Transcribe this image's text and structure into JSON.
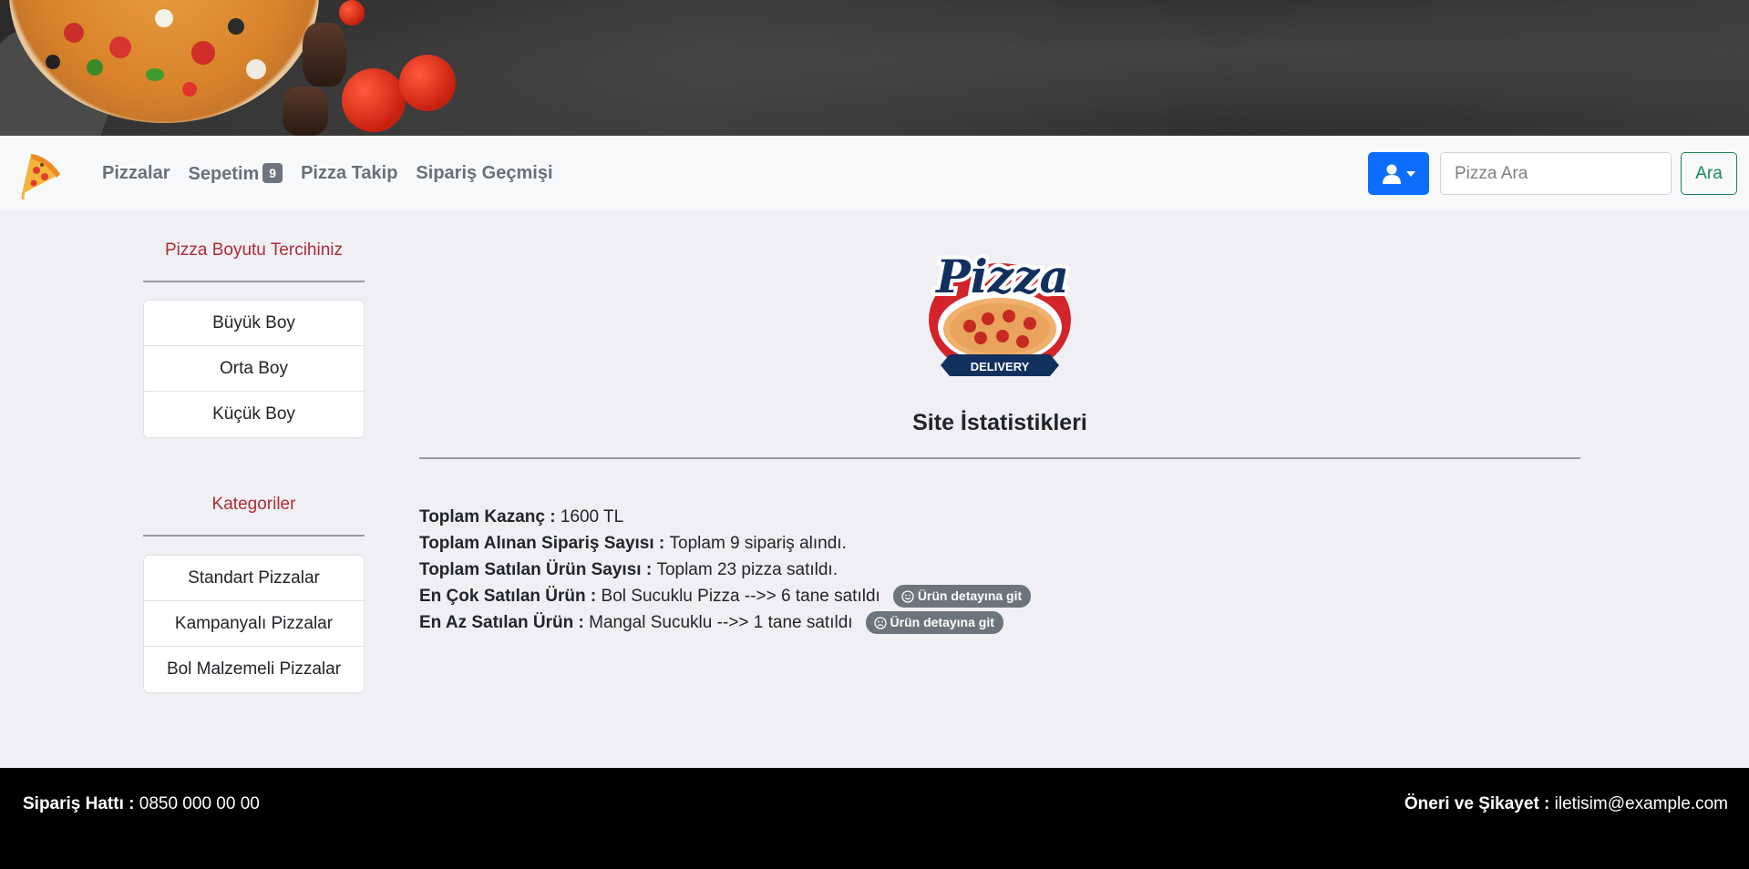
{
  "colors": {
    "primary": "#0d6efd",
    "success": "#198754",
    "danger_text": "#b02a37",
    "secondary_badge": "#6c757d",
    "footer_bg": "#000000"
  },
  "nav": {
    "logo_icon": "pizza-slice-icon",
    "links": {
      "pizzalar": "Pizzalar",
      "sepetim": "Sepetim",
      "sepetim_count": "9",
      "pizza_takip": "Pizza Takip",
      "siparis_gecmisi": "Sipariş Geçmişi"
    },
    "user_icon": "user-icon",
    "search_placeholder": "Pizza Ara",
    "search_button": "Ara"
  },
  "sidebar": {
    "size_title": "Pizza Boyutu Tercihiniz",
    "sizes": [
      "Büyük Boy",
      "Orta Boy",
      "Küçük Boy"
    ],
    "category_title": "Kategoriler",
    "categories": [
      "Standart Pizzalar",
      "Kampanyalı Pizzalar",
      "Bol Malzemeli Pizzalar"
    ]
  },
  "main": {
    "logo_word": "Pizza",
    "logo_ribbon": "DELIVERY",
    "title": "Site İstatistikleri",
    "stats": [
      {
        "label": "Toplam Kazanç :",
        "value": "1600 TL"
      },
      {
        "label": "Toplam Alınan Sipariş Sayısı :",
        "value": "Toplam 9 sipariş alındı."
      },
      {
        "label": "Toplam Satılan Ürün Sayısı :",
        "value": "Toplam 23 pizza satıldı."
      },
      {
        "label": "En Çok Satılan Ürün :",
        "value": "Bol Sucuklu Pizza -->> 6 tane satıldı",
        "button": "Ürün detayına git",
        "icon": "smile-icon"
      },
      {
        "label": "En Az Satılan Ürün :",
        "value": "Mangal Sucuklu -->> 1 tane satıldı",
        "button": "Ürün detayına git",
        "icon": "frown-icon"
      }
    ]
  },
  "footer": {
    "left_label": "Sipariş Hattı :",
    "left_value": "0850 000 00 00",
    "right_label": "Öneri ve Şikayet :",
    "right_value": "iletisim@example.com"
  }
}
